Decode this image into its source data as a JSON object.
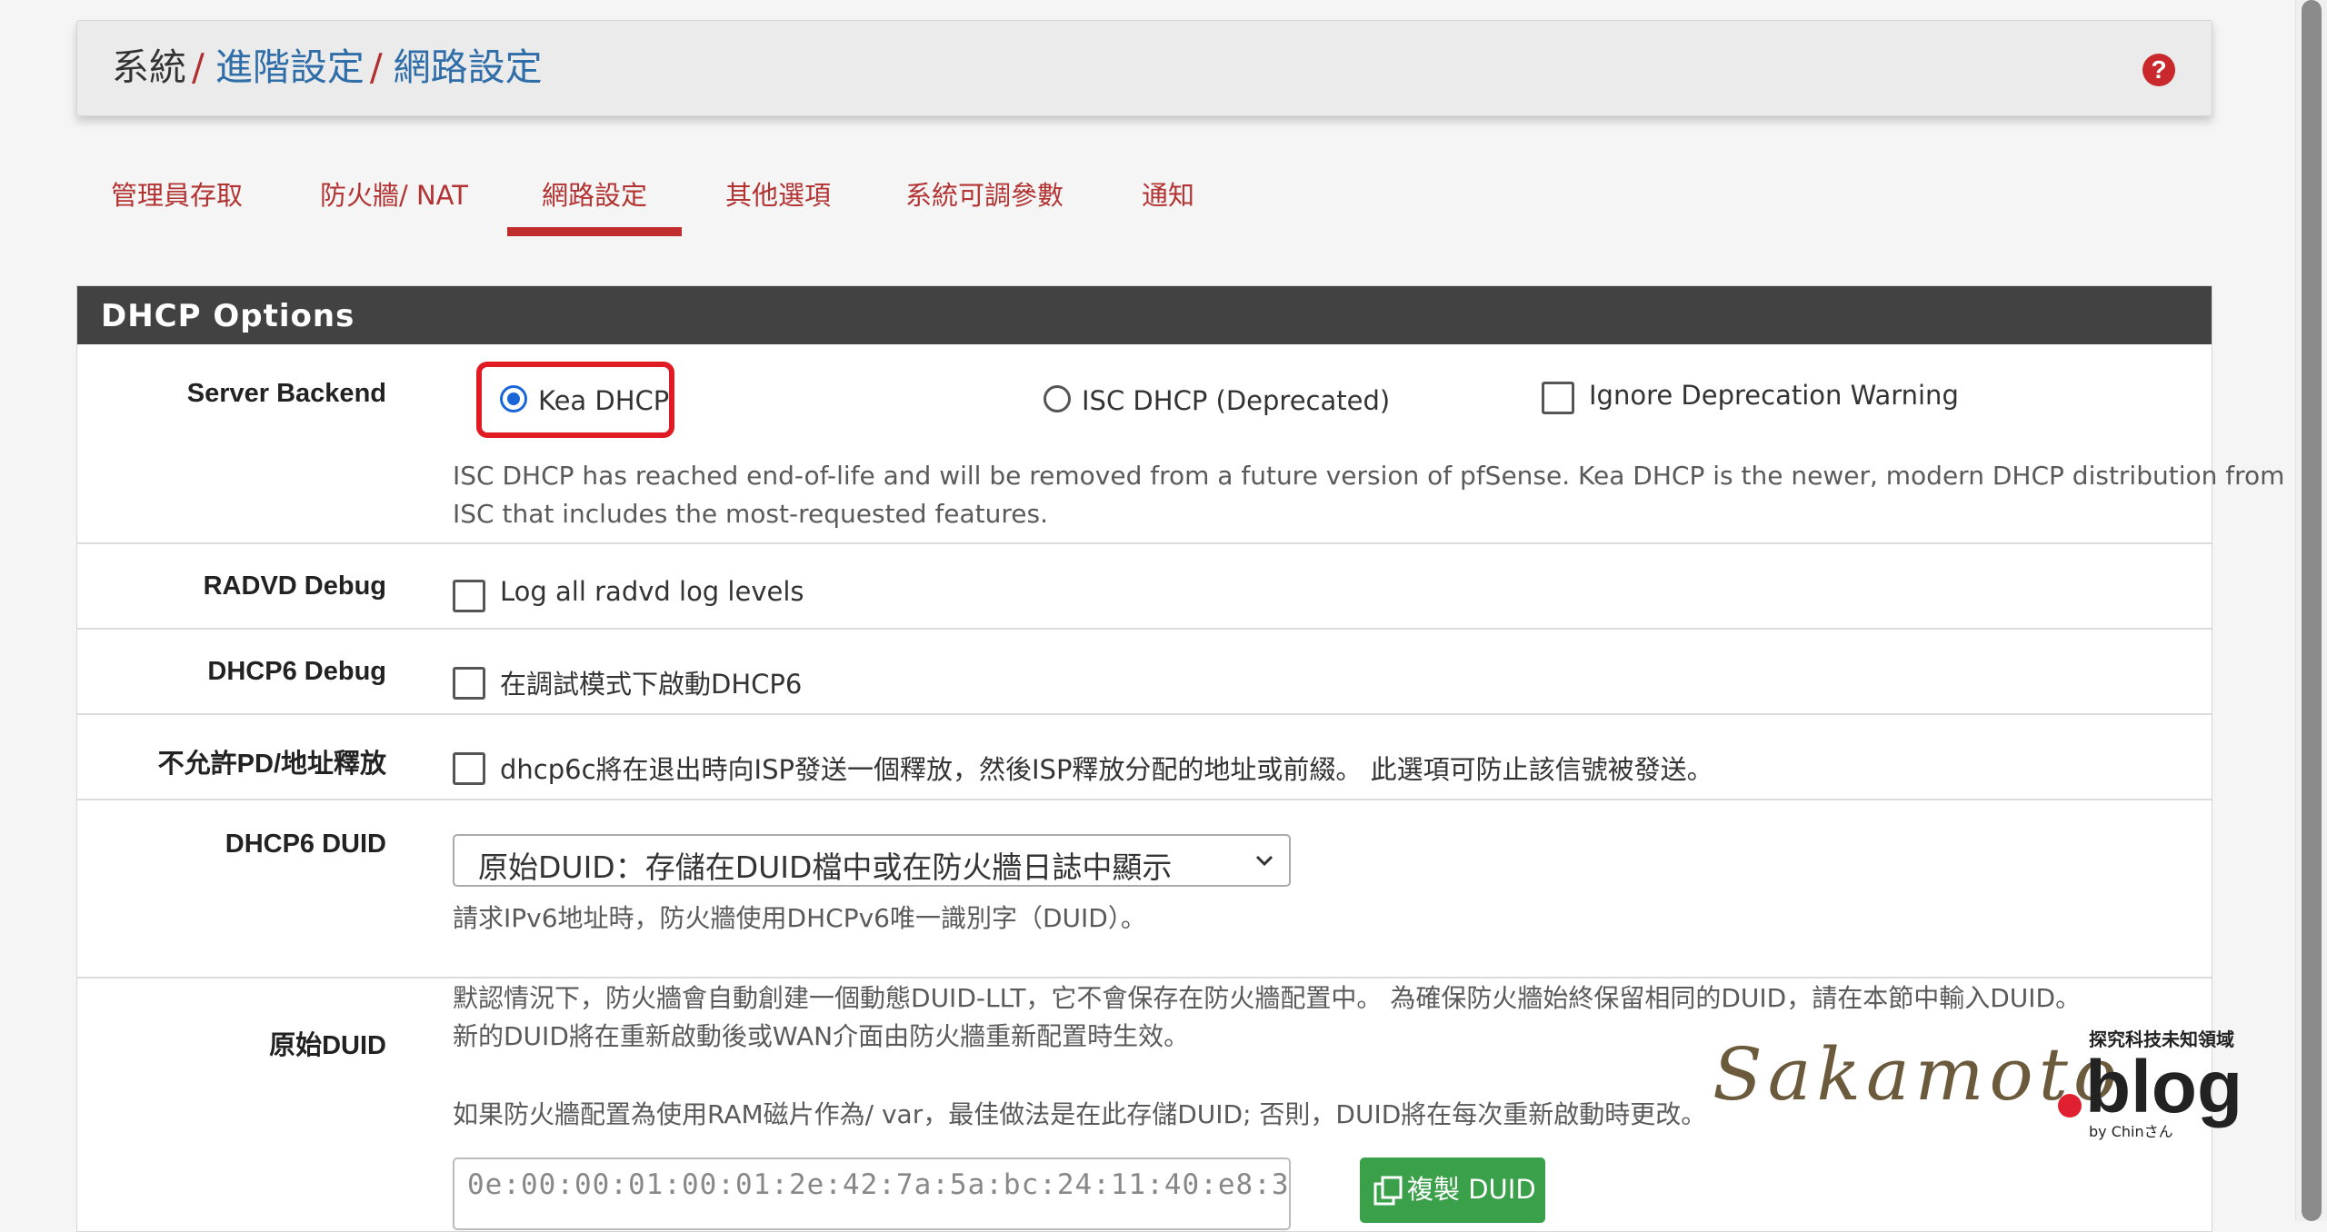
{
  "breadcrumb": {
    "root": "系統",
    "sep": "/",
    "level2": "進階設定",
    "level3": "網路設定"
  },
  "tabs": [
    {
      "label": "管理員存取"
    },
    {
      "label": "防火牆/ NAT"
    },
    {
      "label": "網路設定"
    },
    {
      "label": "其他選項"
    },
    {
      "label": "系統可調參數"
    },
    {
      "label": "通知"
    }
  ],
  "panel": {
    "title": "DHCP Options"
  },
  "server_backend": {
    "label": "Server Backend",
    "kea": "Kea DHCP",
    "isc": "ISC DHCP (Deprecated)",
    "ignore": "Ignore Deprecation Warning",
    "help_line1": "ISC DHCP has reached end-of-life and will be removed from a future version of pfSense. Kea DHCP is the newer, modern DHCP distribution from",
    "help_line2": "ISC that includes the most-requested features."
  },
  "radvd_debug": {
    "label": "RADVD Debug",
    "option": "Log all radvd log levels"
  },
  "dhcp6_debug": {
    "label": "DHCP6 Debug",
    "option": "在調試模式下啟動DHCP6"
  },
  "no_release": {
    "label": "不允許PD/地址釋放",
    "option": "dhcp6c將在退出時向ISP發送一個釋放，然後ISP釋放分配的地址或前綴。 此選項可防止該信號被發送。"
  },
  "dhcp6_duid": {
    "label": "DHCP6 DUID",
    "selected": "原始DUID：存儲在DUID檔中或在防火牆日誌中顯示",
    "help1": "請求IPv6地址時，防火牆使用DHCPv6唯一識別字（DUID）。",
    "help2": "默認情況下，防火牆會自動創建一個動態DUID-LLT，它不會保存在防火牆配置中。 為確保防火牆始終保留相同的DUID，請在本節中輸入DUID。",
    "help3": "新的DUID將在重新啟動後或WAN介面由防火牆重新配置時生效。",
    "help4": "如果防火牆配置為使用RAM磁片作為/ var，最佳做法是在此存儲DUID; 否則，DUID將在每次重新啟動時更改。"
  },
  "raw_duid": {
    "label": "原始DUID",
    "placeholder": "0e:00:00:01:00:01:2e:42:7a:5a:bc:24:11:40:e8:3",
    "button": "複製 DUID"
  },
  "watermark": {
    "script": "Sakamoto",
    "brand": "blog",
    "tagline": "探究科技未知領域",
    "by": "by Chinさん"
  }
}
